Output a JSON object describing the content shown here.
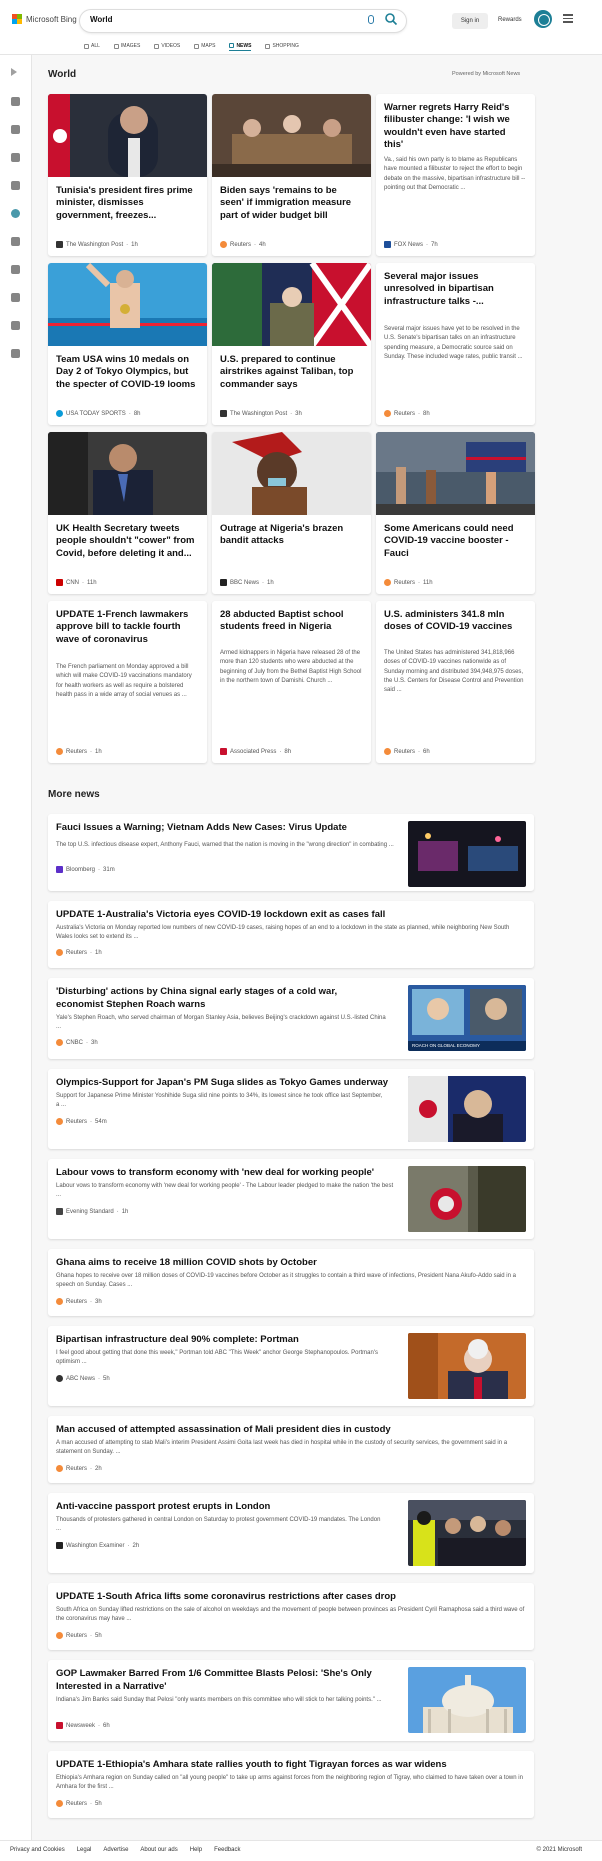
{
  "header": {
    "brand": "Microsoft Bing",
    "search_value": "World",
    "signin_label": "Sign in",
    "rewards_label": "Rewards",
    "tabs": [
      {
        "label": "ALL",
        "icon": "search-icon"
      },
      {
        "label": "IMAGES",
        "icon": "image-icon"
      },
      {
        "label": "VIDEOS",
        "icon": "video-icon"
      },
      {
        "label": "MAPS",
        "icon": "map-pin-icon"
      },
      {
        "label": "NEWS",
        "icon": "news-icon"
      },
      {
        "label": "SHOPPING",
        "icon": "tag-icon"
      }
    ],
    "active_tab": "NEWS",
    "accent": "#1d7f96"
  },
  "rail": {
    "icons": [
      "expand-chevron-icon",
      "home-icon",
      "sports-icon",
      "flag-icon",
      "location-pin-icon",
      "globe-icon",
      "science-icon",
      "rocket-icon",
      "entertainment-icon",
      "money-icon",
      "politics-icon"
    ]
  },
  "world": {
    "title": "World",
    "powered_by": "Powered by Microsoft News",
    "cards": [
      {
        "title": "Tunisia's president fires prime minister, dismisses government, freezes...",
        "source": "The Washington Post",
        "time": "1h"
      },
      {
        "title": "Biden says 'remains to be seen' if immigration measure part of wider budget bill",
        "source": "Reuters",
        "time": "4h"
      },
      {
        "title": "Warner regrets Harry Reid's filibuster change: 'I wish we wouldn't even have started this'",
        "snippet": "Va., said his own party is to blame as Republicans have mounted a filibuster to reject the effort to begin debate on the massive, bipartisan infrastructure bill -- pointing out that Democratic ...",
        "source": "FOX News",
        "time": "7h"
      },
      {
        "title": "Team USA wins 10 medals on Day 2 of Tokyo Olympics, but the specter of COVID-19 looms",
        "source": "USA TODAY SPORTS",
        "time": "8h"
      },
      {
        "title": "U.S. prepared to continue airstrikes against Taliban, top commander says",
        "source": "The Washington Post",
        "time": "3h"
      },
      {
        "title": "Several major issues unresolved in bipartisan infrastructure talks -...",
        "snippet": "Several major issues have yet to be resolved in the U.S. Senate's bipartisan talks on an infrastructure spending measure, a Democratic source said on Sunday. These included wage rates, public transit ...",
        "source": "Reuters",
        "time": "8h"
      },
      {
        "title": "UK Health Secretary tweets people shouldn't \"cower\" from Covid, before deleting it and...",
        "source": "CNN",
        "time": "11h"
      },
      {
        "title": "Outrage at Nigeria's brazen bandit attacks",
        "source": "BBC News",
        "time": "1h"
      },
      {
        "title": "Some Americans could need COVID-19 vaccine booster - Fauci",
        "source": "Reuters",
        "time": "11h"
      },
      {
        "title": "UPDATE 1-French lawmakers approve bill to tackle fourth wave of coronavirus",
        "snippet": "The French parliament on Monday approved a bill which will make COVID-19 vaccinations mandatory for health workers as well as require a bolstered health pass in a wide array of social venues as ...",
        "source": "Reuters",
        "time": "1h"
      },
      {
        "title": "28 abducted Baptist school students freed in Nigeria",
        "snippet": "Armed kidnappers in Nigeria have released 28 of the more than 120 students who were abducted at the beginning of July from the Bethel Baptist High School in the northern town of Damishi. Church ...",
        "source": "Associated Press",
        "time": "8h"
      },
      {
        "title": "U.S. administers 341.8 mln doses of COVID-19 vaccines",
        "snippet": "The United States has administered 341,818,966 doses of COVID-19 vaccines nationwide as of Sunday morning and distributed 394,948,975 doses, the U.S. Centers for Disease Control and Prevention said ...",
        "source": "Reuters",
        "time": "6h"
      }
    ]
  },
  "more_news": {
    "title": "More news",
    "items": [
      {
        "title": "Fauci Issues a Warning; Vietnam Adds New Cases: Virus Update",
        "snippet": "The top U.S. infectious disease expert, Anthony Fauci, warned that the nation is moving in the \"wrong direction\" in combating ...",
        "source": "Bloomberg",
        "time": "31m"
      },
      {
        "title": "UPDATE 1-Australia's Victoria eyes COVID-19 lockdown exit as cases fall",
        "snippet": "Australia's Victoria on Monday reported low numbers of new COVID-19 cases, raising hopes of an end to a lockdown in the state as planned, while neighboring New South Wales looks set to extend its ...",
        "source": "Reuters",
        "time": "1h"
      },
      {
        "title": "'Disturbing' actions by China signal early stages of a cold war, economist Stephen Roach warns",
        "snippet": "Yale's Stephen Roach, who served chairman of Morgan Stanley Asia, believes Beijing's crackdown against U.S.-listed China ...",
        "source": "CNBC",
        "time": "3h",
        "thumb_caption": "ROACH ON GLOBAL ECONOMY"
      },
      {
        "title": "Olympics-Support for Japan's PM Suga slides as Tokyo Games underway",
        "snippet": "Support for Japanese Prime Minister Yoshihide Suga slid nine points to 34%, its lowest since he took office last September, a ...",
        "source": "Reuters",
        "time": "54m"
      },
      {
        "title": "Labour vows to transform economy with 'new deal for working people'",
        "snippet": "Labour vows to transform economy with 'new deal for working people' - The Labour leader pledged to make the nation 'the best ...",
        "source": "Evening Standard",
        "time": "1h"
      },
      {
        "title": "Ghana aims to receive 18 million COVID shots by October",
        "snippet": "Ghana hopes to receive over 18 million doses of COVID-19 vaccines before October as it struggles to contain a third wave of infections, President Nana Akufo-Addo said in a speech on Sunday. Cases ...",
        "source": "Reuters",
        "time": "3h"
      },
      {
        "title": "Bipartisan infrastructure deal 90% complete: Portman",
        "snippet": "I feel good about getting that done this week,\" Portman told ABC \"This Week\" anchor George Stephanopoulos. Portman's optimism ...",
        "source": "ABC News",
        "time": "5h"
      },
      {
        "title": "Man accused of attempted assassination of Mali president dies in custody",
        "snippet": "A man accused of attempting to stab Mali's interim President Assimi Goita last week has died in hospital while in the custody of security services, the government said in a statement on Sunday. ...",
        "source": "Reuters",
        "time": "2h"
      },
      {
        "title": "Anti-vaccine passport protest erupts in London",
        "snippet": "Thousands of protesters gathered in central London on Saturday to protest government COVID-19 mandates. The London ...",
        "source": "Washington Examiner",
        "time": "2h"
      },
      {
        "title": "UPDATE 1-South Africa lifts some coronavirus restrictions after cases drop",
        "snippet": "South Africa on Sunday lifted restrictions on the sale of alcohol on weekdays and the movement of people between provinces as President Cyril Ramaphosa said a third wave of the coronavirus may have ...",
        "source": "Reuters",
        "time": "5h"
      },
      {
        "title": "GOP Lawmaker Barred From 1/6 Committee Blasts Pelosi: 'She's Only Interested in a Narrative'",
        "snippet": "Indiana's Jim Banks said Sunday that Pelosi \"only wants members on this committee who will stick to her talking points.\" ...",
        "source": "Newsweek",
        "time": "6h"
      },
      {
        "title": "UPDATE 1-Ethiopia's Amhara state rallies youth to fight Tigrayan forces as war widens",
        "snippet": "Ethiopia's Amhara region on Sunday called on \"all young people\" to take up arms against forces from the neighboring region of Tigray, who claimed to have taken over a town in Amhara for the first ...",
        "source": "Reuters",
        "time": "5h"
      }
    ]
  },
  "footer": {
    "links": [
      "Privacy and Cookies",
      "Legal",
      "Advertise",
      "About our ads",
      "Help",
      "Feedback"
    ],
    "copyright": "© 2021 Microsoft"
  }
}
